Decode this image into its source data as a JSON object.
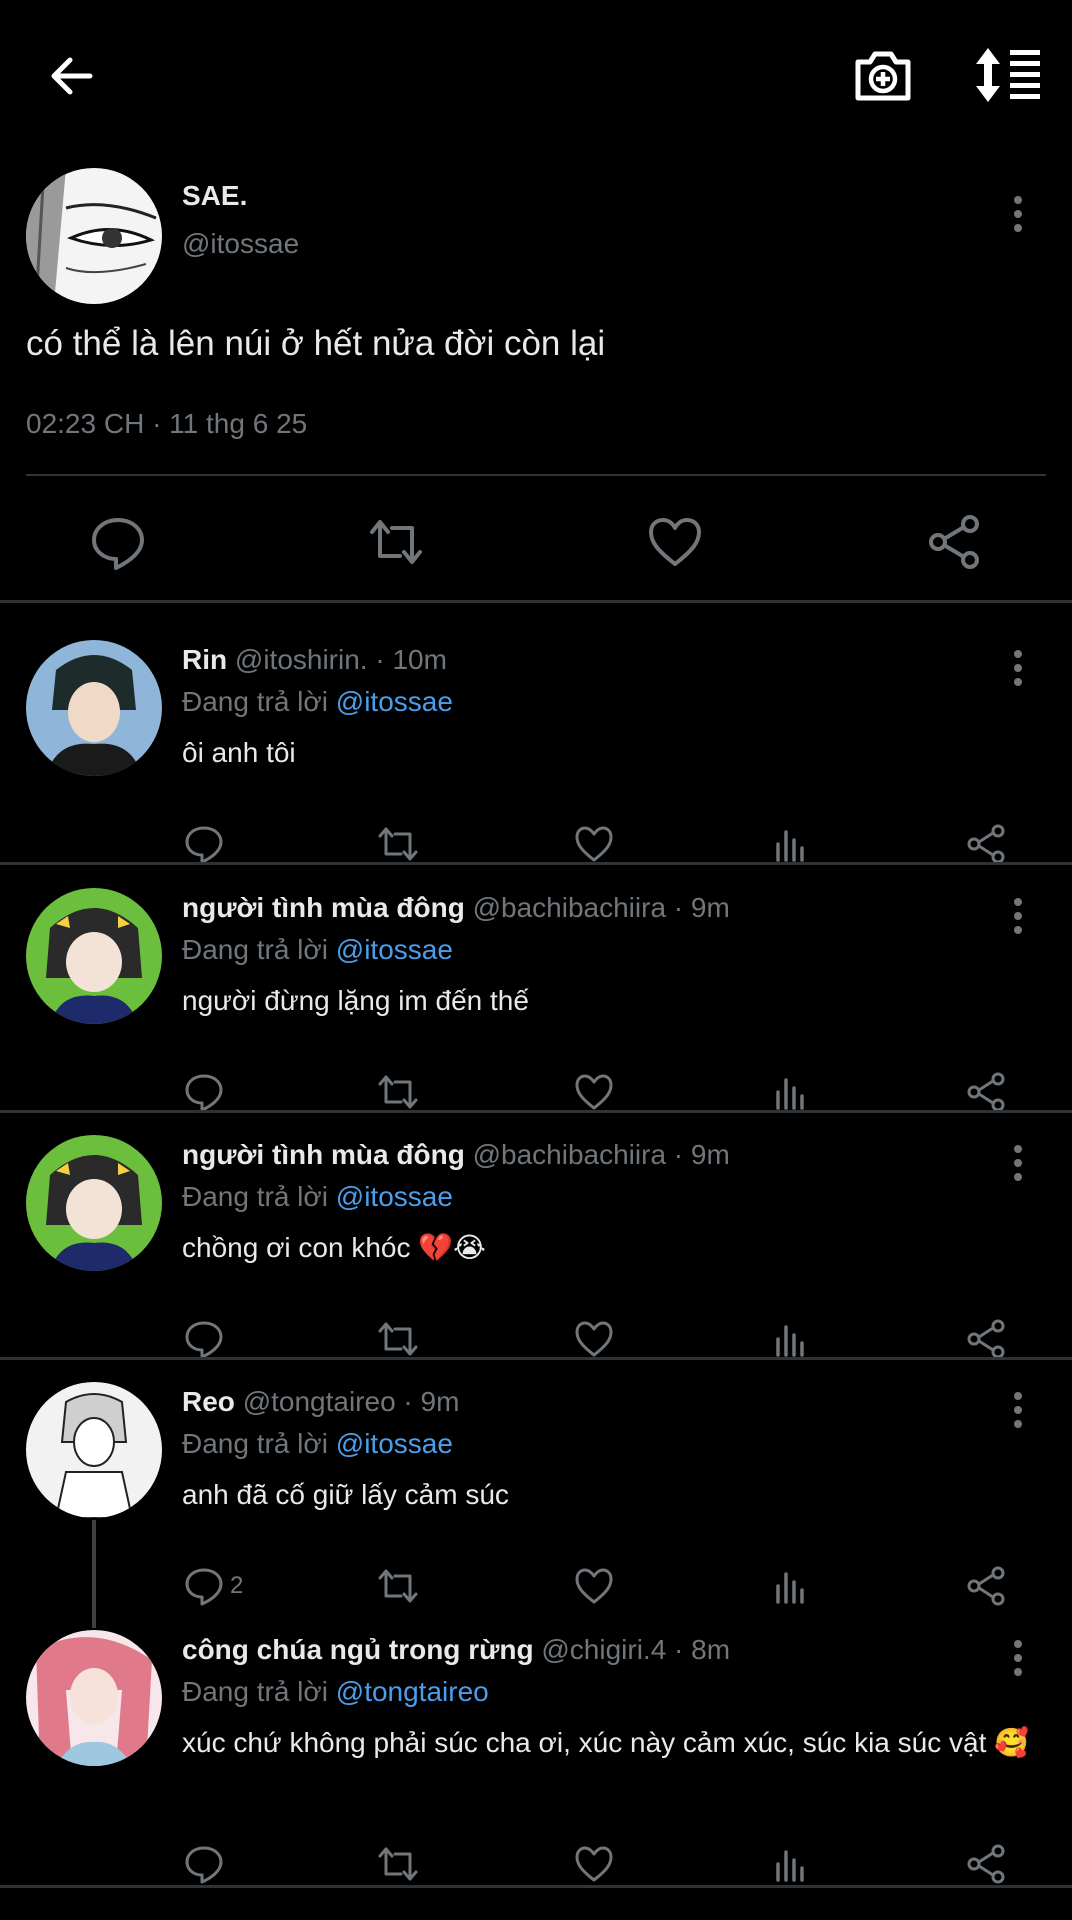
{
  "main": {
    "name": "SAE.",
    "handle": "@itossae",
    "text": "có thể là lên núi ở hết nửa đời còn lại",
    "timestamp": "02:23 CH · 11 thg 6 25"
  },
  "replying_prefix": "Đang trả lời",
  "replies": [
    {
      "name": "Rin",
      "meta": "@itoshirin. · 10m",
      "mention": "@itossae",
      "text": "ôi anh tôi",
      "reply_count": "",
      "avatar_bg": "#8fb6d8"
    },
    {
      "name": "người tình mùa đông",
      "meta": "@bachibachiira · 9m",
      "mention": "@itossae",
      "text": "người đừng lặng im đến thế",
      "reply_count": "",
      "avatar_bg": "#6cbf3c"
    },
    {
      "name": "người tình mùa đông",
      "meta": "@bachibachiira · 9m",
      "mention": "@itossae",
      "text": "chồng ơi con khóc 💔😭",
      "reply_count": "",
      "avatar_bg": "#6cbf3c"
    },
    {
      "name": "Reo",
      "meta": "@tongtaireo · 9m",
      "mention": "@itossae",
      "text": "anh đã cố giữ lấy cảm súc",
      "reply_count": "2",
      "avatar_bg": "#f2f2f2"
    },
    {
      "name": "công chúa ngủ trong rừng",
      "meta": "@chigiri.4 · 8m",
      "mention": "@tongtaireo",
      "text": "xúc chứ không phải súc cha ơi, xúc này cảm xúc, súc kia súc vật 🥰",
      "reply_count": "",
      "avatar_bg": "#e07a8a"
    }
  ],
  "icons": {
    "back": "arrow-left-icon",
    "camera": "camera-plus-icon",
    "sort": "sort-icon",
    "reply": "comment-icon",
    "retweet": "retweet-icon",
    "like": "heart-icon",
    "views": "bar-chart-icon",
    "share": "share-icon",
    "more": "more-vertical-icon"
  },
  "colors": {
    "background": "#000000",
    "text": "#e7e9ea",
    "muted": "#71767b",
    "mention": "#4a9eeb",
    "divider": "#2f3336"
  }
}
